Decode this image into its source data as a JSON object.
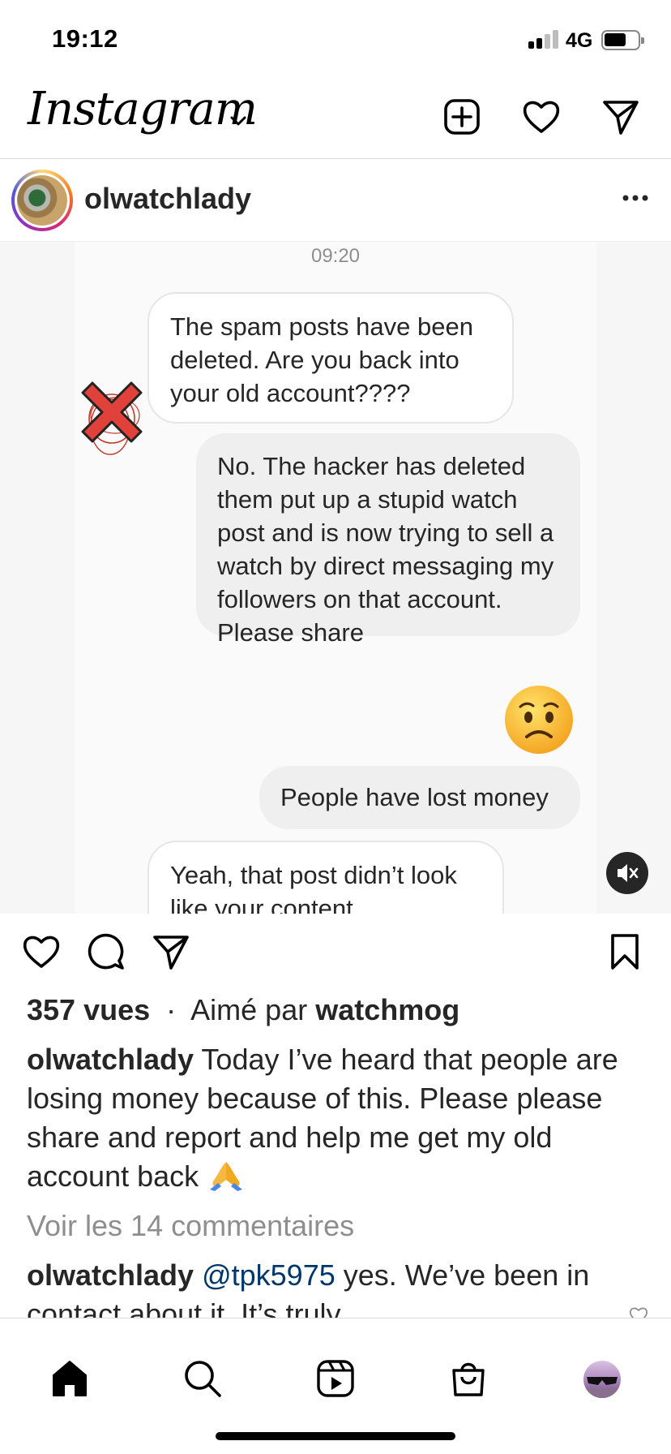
{
  "status_bar": {
    "time": "19:12",
    "network": "4G"
  },
  "header": {
    "logo_text": "Instagram"
  },
  "post": {
    "username": "olwatchlady",
    "media": {
      "timestamp": "09:20",
      "messages": [
        {
          "side": "received",
          "text": "The spam posts have been deleted. Are you back into your old account????"
        },
        {
          "side": "sent",
          "text": "No.  The hacker has deleted them put up a stupid watch post and is now trying to sell a watch by direct messaging my followers on that account.  Please share"
        },
        {
          "side": "sent",
          "text": "People have lost money"
        },
        {
          "side": "received",
          "text": "Yeah, that post didn’t look like your content"
        }
      ]
    },
    "views": "357 vues",
    "separator": "·",
    "liked_by_prefix": "Aimé par",
    "liked_by_user": "watchmog",
    "caption_user": "olwatchlady",
    "caption_text": "Today I’ve heard that people are losing money because of this.  Please please share and report and help me get my old account back",
    "view_comments": "Voir les 14 commentaires",
    "comment": {
      "user": "olwatchlady",
      "mention": "@tpk5975",
      "text": "yes.  We’ve been in contact about it.  It’s truly"
    }
  },
  "icons": {
    "header": [
      "new-post-icon",
      "heart-icon",
      "direct-message-icon"
    ],
    "actions": [
      "like-icon",
      "comment-icon",
      "share-icon",
      "save-icon"
    ],
    "nav": [
      "home-icon",
      "search-icon",
      "reels-icon",
      "shop-icon",
      "profile-avatar"
    ]
  }
}
